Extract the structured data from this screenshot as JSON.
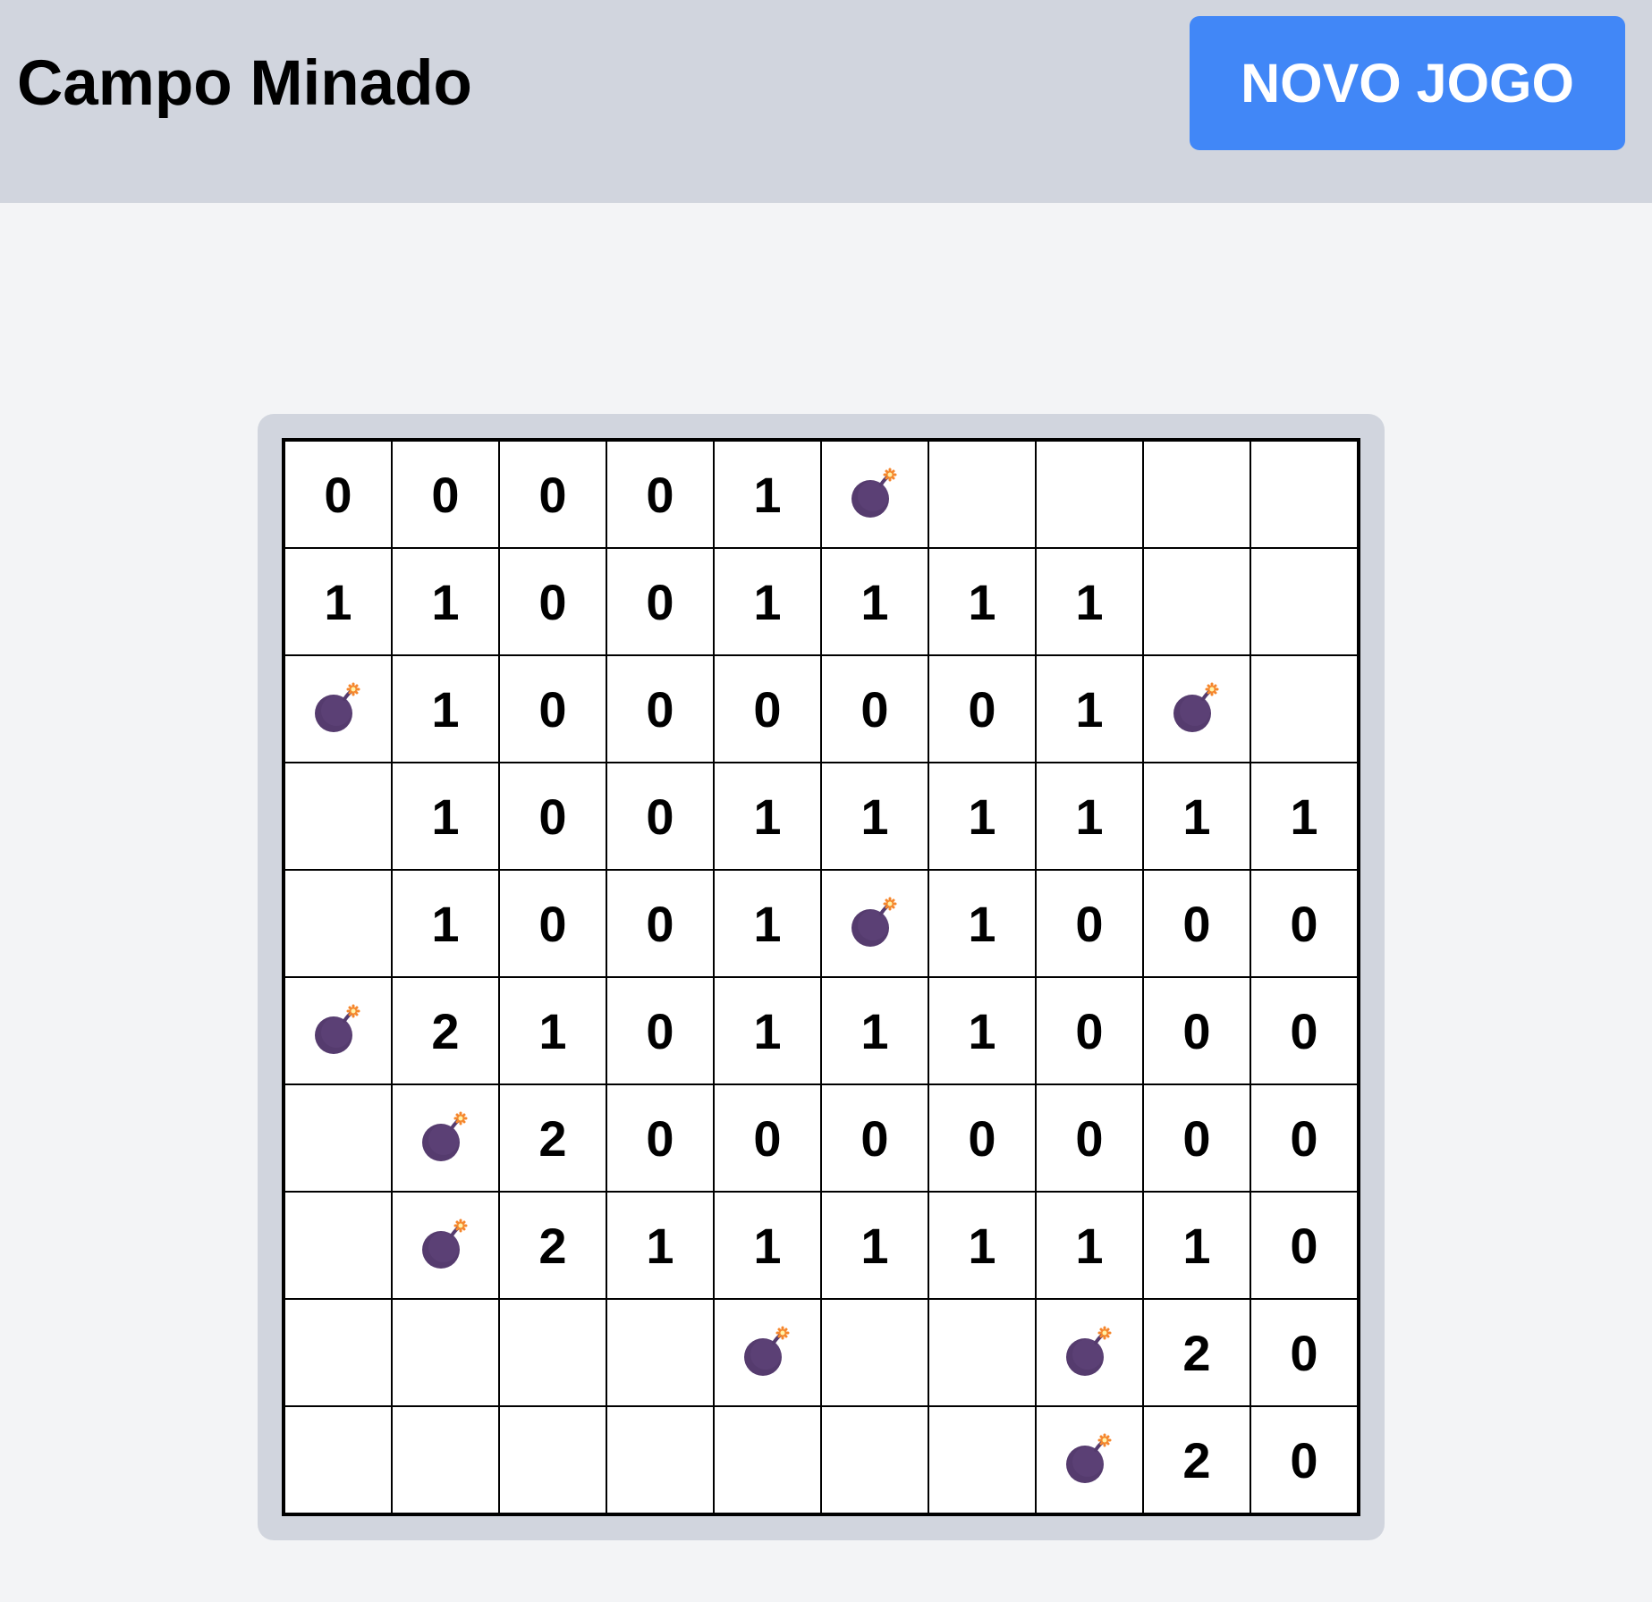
{
  "header": {
    "title": "Campo Minado",
    "new_game_label": "NOVO JOGO"
  },
  "colors": {
    "header_bg": "#d1d5de",
    "page_bg": "#f3f4f6",
    "button_bg": "#4187f7",
    "bomb": "#553b6e",
    "fuse": "#f5872d"
  },
  "board": {
    "rows": 10,
    "cols": 10,
    "mine_icon": "bomb-icon",
    "legend": "M = mine, empty string = unrevealed cell, digit = revealed adjacent-mine count",
    "cells": [
      [
        "0",
        "0",
        "0",
        "0",
        "1",
        "M",
        "",
        "",
        "",
        ""
      ],
      [
        "1",
        "1",
        "0",
        "0",
        "1",
        "1",
        "1",
        "1",
        "",
        ""
      ],
      [
        "M",
        "1",
        "0",
        "0",
        "0",
        "0",
        "0",
        "1",
        "M",
        ""
      ],
      [
        "",
        "1",
        "0",
        "0",
        "1",
        "1",
        "1",
        "1",
        "1",
        "1"
      ],
      [
        "",
        "1",
        "0",
        "0",
        "1",
        "M",
        "1",
        "0",
        "0",
        "0"
      ],
      [
        "M",
        "2",
        "1",
        "0",
        "1",
        "1",
        "1",
        "0",
        "0",
        "0"
      ],
      [
        "",
        "M",
        "2",
        "0",
        "0",
        "0",
        "0",
        "0",
        "0",
        "0"
      ],
      [
        "",
        "M",
        "2",
        "1",
        "1",
        "1",
        "1",
        "1",
        "1",
        "0"
      ],
      [
        "",
        "",
        "",
        "",
        "M",
        "",
        "",
        "M",
        "2",
        "0"
      ],
      [
        "",
        "",
        "",
        "",
        "",
        "",
        "",
        "M",
        "2",
        "0"
      ]
    ]
  }
}
